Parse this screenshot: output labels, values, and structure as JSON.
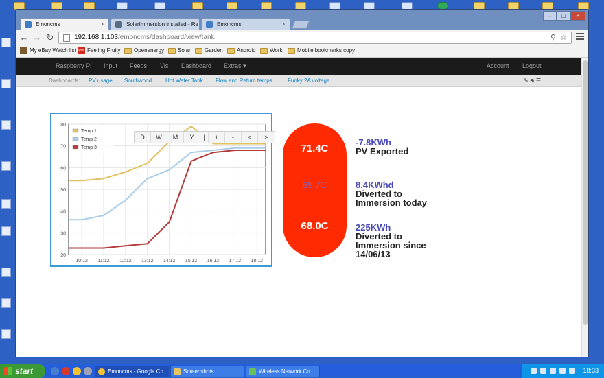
{
  "browser": {
    "tabs": [
      {
        "title": "Emoncms",
        "active": true
      },
      {
        "title": "SolarImmersion installed - Re",
        "active": false
      },
      {
        "title": "Emoncms",
        "active": false
      }
    ],
    "address": {
      "host": "192.168.1.103",
      "path": "/emoncms/dashboard/view/tank"
    },
    "bookmarks": [
      "My eBay Watch list",
      "Feeling Fruity",
      "Openenergy",
      "Solar",
      "Garden",
      "Android",
      "Work",
      "Mobile bookmarks copy"
    ]
  },
  "navbar": {
    "left": [
      "Raspberry PI",
      "Input",
      "Feeds",
      "Vis",
      "Dashboard",
      "Extras"
    ],
    "right": [
      "Account",
      "Logout"
    ]
  },
  "dashboards": {
    "label": "Dashboards:",
    "items": [
      "PV usage",
      "Southwood",
      "Hot Water Tank",
      "Flow and Return temps",
      "Funky 2A voltage"
    ]
  },
  "chart_data": {
    "type": "line",
    "x": [
      "10:12",
      "11:12",
      "12:12",
      "13:12",
      "14:12",
      "15:12",
      "16:12",
      "17:12",
      "18:12"
    ],
    "ylim": [
      20,
      80
    ],
    "yticks": [
      20,
      30,
      40,
      50,
      60,
      70,
      80
    ],
    "grid": true,
    "legend_position": "top-left",
    "range_buttons": [
      "D",
      "W",
      "M",
      "Y",
      "|",
      "+",
      "-",
      "<",
      ">"
    ],
    "series": [
      {
        "name": "Temp 1",
        "color": "#e2c15e",
        "values": [
          54,
          55,
          58,
          62,
          72,
          79,
          71,
          71,
          71
        ]
      },
      {
        "name": "Temp 2",
        "color": "#a9cce8",
        "values": [
          36,
          38,
          45,
          55,
          59,
          67,
          68,
          69,
          69
        ]
      },
      {
        "name": "Temp 3",
        "color": "#b23a3a",
        "values": [
          23,
          23,
          24,
          25,
          35,
          63,
          67,
          68,
          68
        ]
      }
    ]
  },
  "stats": {
    "temps": [
      "71.4C",
      "69.7C",
      "68.0C"
    ],
    "pv_exported_value": "-7.8KWh",
    "pv_exported_label": "PV Exported",
    "diverted_today_value": "8.4KWhd",
    "diverted_today_label_1": "Diverted to",
    "diverted_today_label_2": "Immersion today",
    "diverted_since_value": "225KWh",
    "diverted_since_label_1": "Diverted to",
    "diverted_since_label_2": "Immersion since",
    "diverted_since_label_3": "14/06/13"
  },
  "taskbar": {
    "start": "start",
    "windows": [
      "Emoncms - Google Ch...",
      "Screenshots",
      "Wireless Network Co..."
    ],
    "clock": "18:33"
  }
}
